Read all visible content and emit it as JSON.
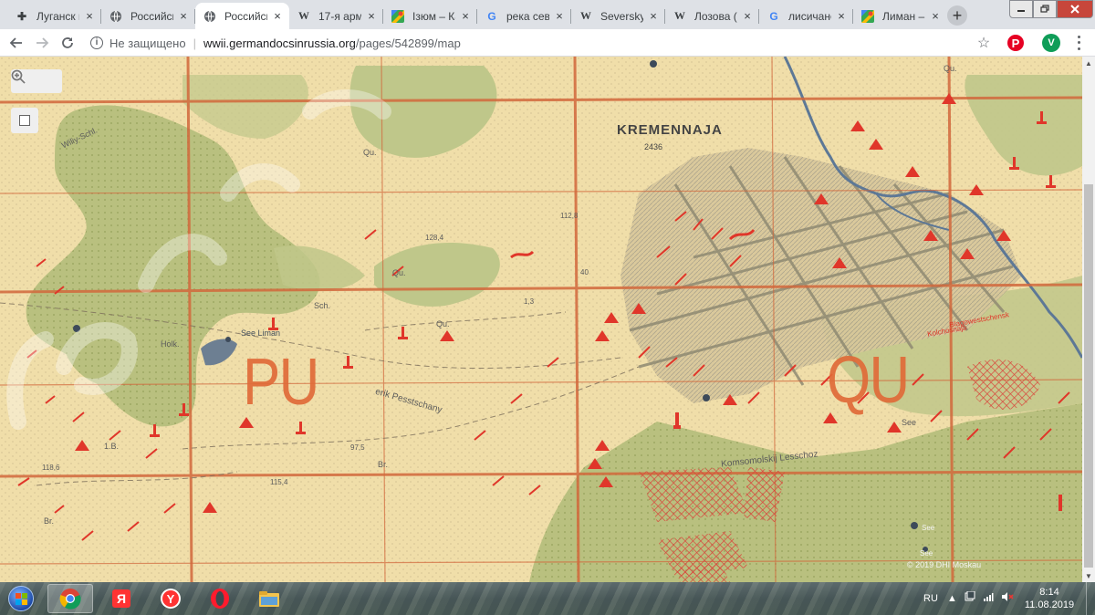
{
  "browser": {
    "tabs": [
      {
        "icon": "cross-icon",
        "title": "Луганск и"
      },
      {
        "icon": "globe-icon",
        "title": "Российск"
      },
      {
        "icon": "globe-icon",
        "title": "Российск",
        "active": true
      },
      {
        "icon": "wikipedia-icon",
        "title": "17-я арм"
      },
      {
        "icon": "google-maps-icon",
        "title": "Ізюм – Ка"
      },
      {
        "icon": "google-icon",
        "title": "река севе"
      },
      {
        "icon": "wikipedia-icon",
        "title": "Seversky"
      },
      {
        "icon": "wikipedia-icon",
        "title": "Лозова ("
      },
      {
        "icon": "google-icon",
        "title": "лисичанс"
      },
      {
        "icon": "google-maps-icon",
        "title": "Лиман –"
      }
    ],
    "new_tab_symbol": "+",
    "close_symbol": "×",
    "address": {
      "security_text": "Не защищено",
      "separator": "|",
      "host": "wwii.germandocsinrussia.org",
      "path": "/pages/542899/map"
    },
    "profile_initial": "V",
    "pinterest_letter": "P"
  },
  "map": {
    "town_name": "KREMENNAJA",
    "town_number": "2436",
    "grid_label_left": "PU",
    "grid_label_right": "QU",
    "copyright": "© 2019 DHI Moskau",
    "watermark": "germandocsinrussia",
    "labels": [
      "Wiliy-Schl.",
      "Qu.",
      "Qu.",
      "Qu.",
      "Qu.",
      "See",
      "See Liman",
      "Holk.",
      "erik Pesstschany",
      "Komsomolskij Lesschoz",
      "1.B.",
      "Br.",
      "Br.",
      "Sch.",
      "112,8",
      "128,4",
      "1,3",
      "40",
      "97,5",
      "115,4",
      "118,6",
      "See",
      "See",
      "Kolchosnaja",
      "Blagowestschensk"
    ]
  },
  "taskbar": {
    "language": "RU",
    "time": "8:14",
    "date": "11.08.2019",
    "apps": [
      "chrome-icon",
      "yandex-icon",
      "yandex-browser-icon",
      "opera-icon",
      "file-explorer-icon"
    ]
  },
  "colors": {
    "map_paper": "#efdca9",
    "forest": "#b7bf7d",
    "grid_red": "#d2683c",
    "symbol_red": "#e0362a",
    "river_blue": "#5d7896"
  }
}
